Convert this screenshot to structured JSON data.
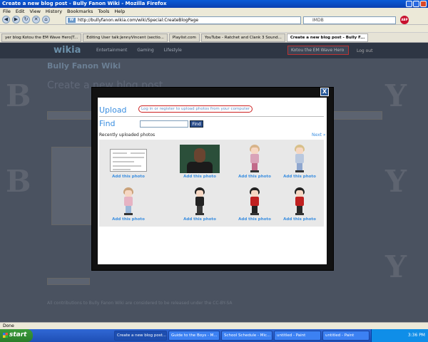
{
  "window": {
    "title": "Create a new blog post - Bully Fanon Wiki - Mozilla Firefox",
    "menu": [
      "File",
      "Edit",
      "View",
      "History",
      "Bookmarks",
      "Tools",
      "Help"
    ]
  },
  "nav": {
    "url": "http://bullyfanon.wikia.com/wiki/Special:CreateBlogPage",
    "search_value": "IMDB",
    "addon": "ABP"
  },
  "tabs": [
    {
      "label": "yer blog:Kotou the EM Wave Hero|T...",
      "active": false
    },
    {
      "label": "Editing User talk:JennyVincent (sectio...",
      "active": false
    },
    {
      "label": "Playlist.com",
      "active": false
    },
    {
      "label": "YouTube - Ratchet and Clank 3 Sound...",
      "active": false
    },
    {
      "label": "Create a new blog post - Bully F...",
      "active": true
    }
  ],
  "page": {
    "logo": "wikia",
    "nav_items": [
      "Entertainment",
      "Gaming",
      "Lifestyle"
    ],
    "user_button": "Kotou the EM Wave Hero",
    "logout": "Log out",
    "wiki_title": "Bully Fanon Wiki",
    "heading": "Create a new blog post",
    "footer": "All contributions to Bully Fanon Wiki are considered to be released under the CC-BY-SA"
  },
  "modal": {
    "close_label": "X",
    "upload_title": "Upload",
    "upload_link": "Log in or register to upload photos from your computer",
    "find_title": "Find",
    "find_value": "",
    "find_button": "Find",
    "recent_label": "Recently uploaded photos",
    "next_label": "Next »",
    "photos": [
      {
        "kind": "document",
        "add_label": "Add this photo"
      },
      {
        "kind": "portrait",
        "add_label": "Add this photo"
      },
      {
        "kind": "avatar",
        "hair": "#d8b48a",
        "shirt": "#d9a3b8",
        "legs": "#c26a8a",
        "add_label": "Add this photo"
      },
      {
        "kind": "avatar",
        "hair": "#d8c08a",
        "shirt": "#b9c8df",
        "legs": "#8fa7cf",
        "add_label": "Add this photo"
      },
      {
        "kind": "avatar",
        "hair": "#caa27a",
        "shirt": "#e6b3c3",
        "legs": "#9ab7d9",
        "add_label": "Add this photo"
      },
      {
        "kind": "avatar",
        "hair": "#222222",
        "shirt": "#222222",
        "legs": "#3a3a3a",
        "add_label": "Add this photo"
      },
      {
        "kind": "avatar",
        "hair": "#222222",
        "shirt": "#c02020",
        "legs": "#222222",
        "add_label": "Add this photo"
      },
      {
        "kind": "avatar",
        "hair": "#222222",
        "shirt": "#c02020",
        "legs": "#2a2a2a",
        "add_label": "Add this photo"
      }
    ]
  },
  "status": {
    "text": "Done"
  },
  "taskbar": {
    "start": "start",
    "items": [
      "Create a new blog post...",
      "Guide to the Boys - M...",
      "School Schedule - Mic...",
      "untitled - Paint",
      "untitled - Paint"
    ],
    "clock": "3:36 PM"
  }
}
